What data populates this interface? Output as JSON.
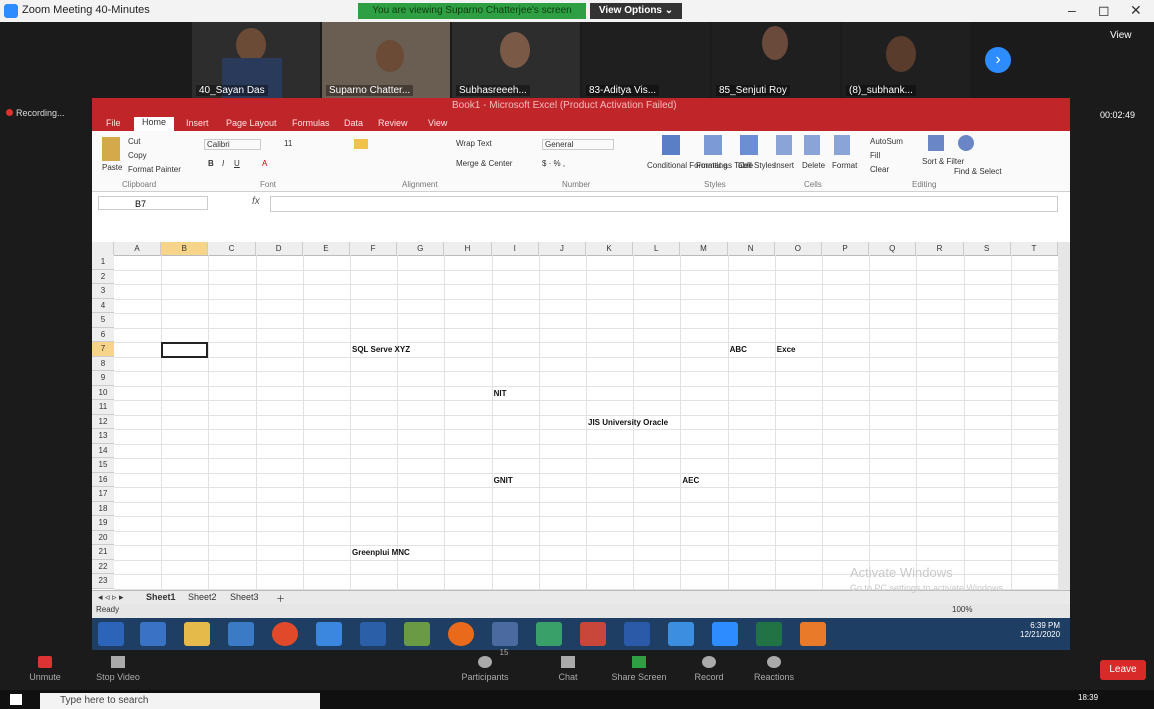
{
  "zoom": {
    "window_title": "Zoom Meeting 40-Minutes",
    "viewing_banner": "You are viewing Suparno Chatterjee's screen",
    "view_options": "View Options ⌄",
    "view_button": "View",
    "recording_label": "Recording...",
    "timer": "00:02:49",
    "participants": [
      {
        "name": "40_Sayan Das",
        "color": "#4a3a2a"
      },
      {
        "name": "Suparno Chatter...",
        "color": "#5a4a3a"
      },
      {
        "name": "Subhasreeeh...",
        "color": "#3b3b3b"
      },
      {
        "name": "83-Aditya Vis...",
        "color": "#1f1f1f"
      },
      {
        "name": "85_Senjuti Roy",
        "color": "#3b3b3b"
      },
      {
        "name": "(8)_subhank...",
        "color": "#3b3b3b"
      }
    ],
    "controls": [
      "Unmute",
      "Stop Video",
      "Participants",
      "Chat",
      "Share Screen",
      "Record",
      "Reactions"
    ],
    "participants_count": "15",
    "leave": "Leave"
  },
  "excel": {
    "title": "Book1 - Microsoft Excel (Product Activation Failed)",
    "tabs": [
      "File",
      "Home",
      "Insert",
      "Page Layout",
      "Formulas",
      "Data",
      "Review",
      "View"
    ],
    "active_tab": "Home",
    "ribbon": {
      "clipboard": {
        "paste": "Paste",
        "cut": "Cut",
        "copy": "Copy",
        "format_painter": "Format Painter",
        "group": "Clipboard"
      },
      "font": {
        "name": "Calibri",
        "size": "11",
        "group": "Font"
      },
      "alignment": {
        "wrap": "Wrap Text",
        "merge": "Merge & Center",
        "group": "Alignment"
      },
      "number": {
        "format": "General",
        "group": "Number"
      },
      "styles": {
        "conditional": "Conditional Formatting",
        "format_table": "Format as Table",
        "cell_styles": "Cell Styles",
        "group": "Styles"
      },
      "cells": {
        "insert": "Insert",
        "delete": "Delete",
        "format": "Format",
        "group": "Cells"
      },
      "editing": {
        "autosum": "AutoSum",
        "fill": "Fill",
        "clear": "Clear",
        "sort": "Sort & Filter",
        "find": "Find & Select",
        "group": "Editing"
      }
    },
    "namebox": "B7",
    "fx": "fx",
    "columns": [
      "A",
      "B",
      "C",
      "D",
      "E",
      "F",
      "G",
      "H",
      "I",
      "J",
      "K",
      "L",
      "M",
      "N",
      "O",
      "P",
      "Q",
      "R",
      "S",
      "T"
    ],
    "rows": [
      "1",
      "2",
      "3",
      "4",
      "5",
      "6",
      "7",
      "8",
      "9",
      "10",
      "11",
      "12",
      "13",
      "14",
      "15",
      "16",
      "17",
      "18",
      "19",
      "20",
      "21",
      "22",
      "23"
    ],
    "cells": [
      {
        "ref": "F7",
        "text": "SQL Serve XYZ"
      },
      {
        "ref": "N7",
        "text": "ABC"
      },
      {
        "ref": "O7",
        "text": "Exce"
      },
      {
        "ref": "I10",
        "text": "NIT"
      },
      {
        "ref": "K12",
        "text": "JIS University Oracle"
      },
      {
        "ref": "I16",
        "text": "GNIT"
      },
      {
        "ref": "M16",
        "text": "AEC"
      },
      {
        "ref": "F21",
        "text": "Greenplui MNC"
      }
    ],
    "sheets": [
      "Sheet1",
      "Sheet2",
      "Sheet3"
    ],
    "active_sheet": "Sheet1",
    "status": "Ready",
    "zoom": "100%"
  },
  "inner_taskbar": {
    "time": "6:39 PM",
    "date": "12/21/2020"
  },
  "windows": {
    "activate_title": "Activate Windows",
    "activate_sub": "Go to PC settings to activate Windows.",
    "search_placeholder": "Type here to search",
    "clock": "18:39"
  },
  "colors": {
    "excel_accent": "#c0252a",
    "zoom_blue": "#2d8cff",
    "zoom_green": "#2ea043",
    "leave_red": "#d92a2a"
  }
}
